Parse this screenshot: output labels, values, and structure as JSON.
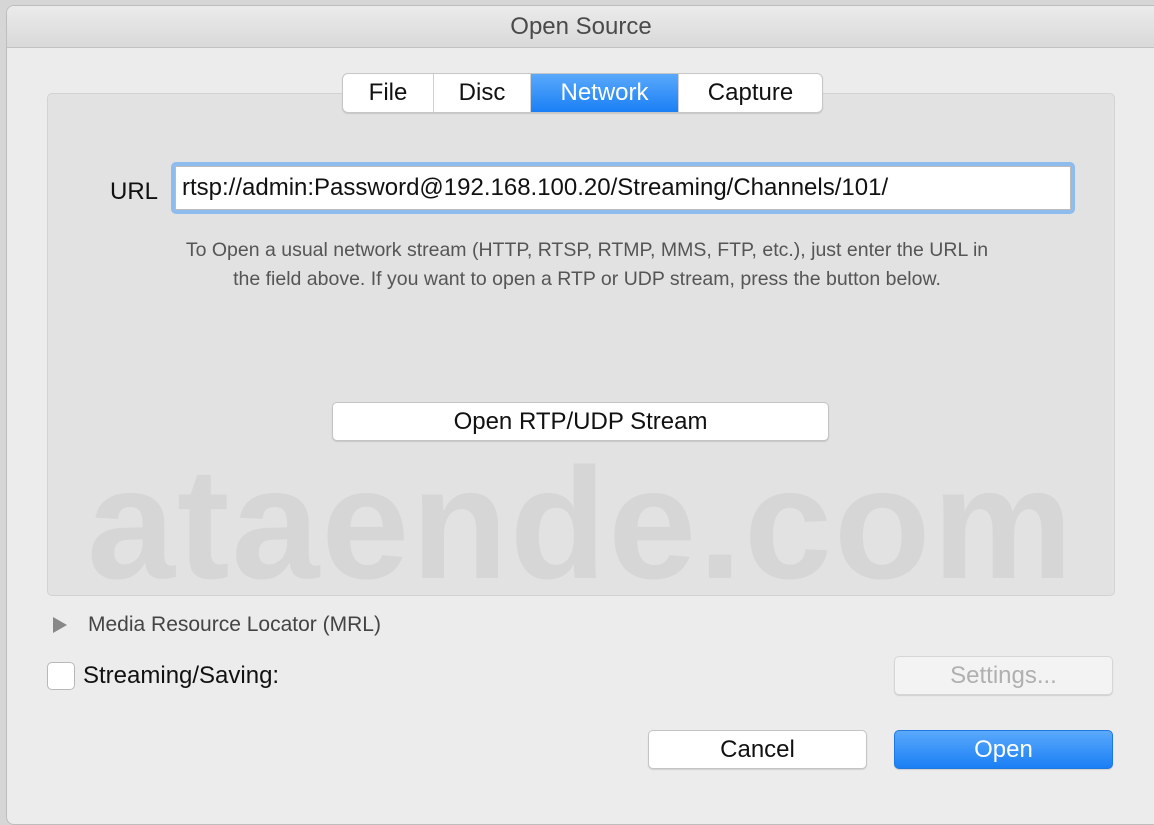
{
  "window": {
    "title": "Open Source"
  },
  "tabs": [
    {
      "label": "File",
      "active": false
    },
    {
      "label": "Disc",
      "active": false
    },
    {
      "label": "Network",
      "active": true
    },
    {
      "label": "Capture",
      "active": false
    }
  ],
  "network": {
    "url_label": "URL",
    "url_value": "rtsp://admin:Password@192.168.100.20/Streaming/Channels/101/",
    "help_line1": "To Open a usual network stream (HTTP, RTSP, RTMP, MMS, FTP, etc.), just enter the URL in",
    "help_line2": "the field above. If you want to open a RTP or UDP stream, press the button below.",
    "rtp_button": "Open RTP/UDP Stream"
  },
  "watermark": "ataende.com",
  "mrl": {
    "label": "Media Resource Locator (MRL)",
    "expanded": false
  },
  "streaming": {
    "label": "Streaming/Saving:",
    "checked": false,
    "settings_button": "Settings..."
  },
  "footer": {
    "cancel": "Cancel",
    "open": "Open"
  },
  "colors": {
    "accent": "#1a7ff5",
    "focus_ring": "#8ebcef"
  }
}
